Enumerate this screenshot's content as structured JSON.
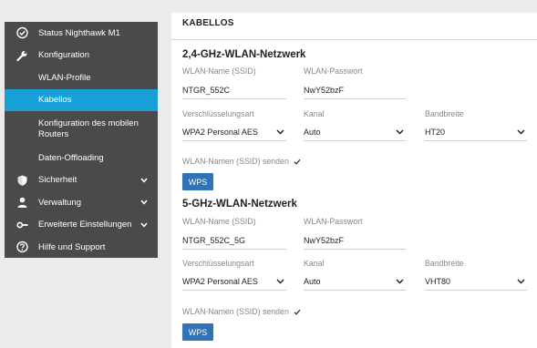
{
  "sidebar": {
    "items": [
      {
        "label": "Status Nighthawk M1",
        "icon": "check-circle-icon"
      },
      {
        "label": "Konfiguration",
        "icon": "wrench-icon"
      },
      {
        "label": "WLAN-Profile"
      },
      {
        "label": "Kabellos",
        "active": true
      },
      {
        "label": "Konfiguration des mobilen Routers"
      },
      {
        "label": "Daten-Offloading"
      },
      {
        "label": "Sicherheit",
        "icon": "shield-icon"
      },
      {
        "label": "Verwaltung",
        "icon": "person-icon"
      },
      {
        "label": "Erweiterte Einstellungen",
        "icon": "key-icon"
      },
      {
        "label": "Hilfe und Support",
        "icon": "help-icon"
      }
    ]
  },
  "page": {
    "title": "KABELLOS"
  },
  "band24": {
    "title": "2,4-GHz-WLAN-Netzwerk",
    "ssid_label": "WLAN-Name (SSID)",
    "ssid_value": "NTGR_552C",
    "password_label": "WLAN-Passwort",
    "password_value": "NwY52bzF",
    "encryption_label": "Verschlüsselungsart",
    "encryption_value": "WPA2 Personal AES",
    "channel_label": "Kanal",
    "channel_value": "Auto",
    "bandwidth_label": "Bandbreite",
    "bandwidth_value": "HT20",
    "broadcast_label": "WLAN-Namen (SSID) senden",
    "broadcast_checked": true,
    "wps_label": "WPS"
  },
  "band5": {
    "title": "5-GHz-WLAN-Netzwerk",
    "ssid_label": "WLAN-Name (SSID)",
    "ssid_value": "NTGR_552C_5G",
    "password_label": "WLAN-Passwort",
    "password_value": "NwY52bzF",
    "encryption_label": "Verschlüsselungsart",
    "encryption_value": "WPA2 Personal AES",
    "channel_label": "Kanal",
    "channel_value": "Auto",
    "bandwidth_label": "Bandbreite",
    "bandwidth_value": "VHT80",
    "broadcast_label": "WLAN-Namen (SSID) senden",
    "broadcast_checked": true,
    "wps_label": "WPS"
  },
  "colors": {
    "sidebar_bg": "#4a4a4a",
    "active": "#189fd8",
    "button": "#2f73b8"
  }
}
